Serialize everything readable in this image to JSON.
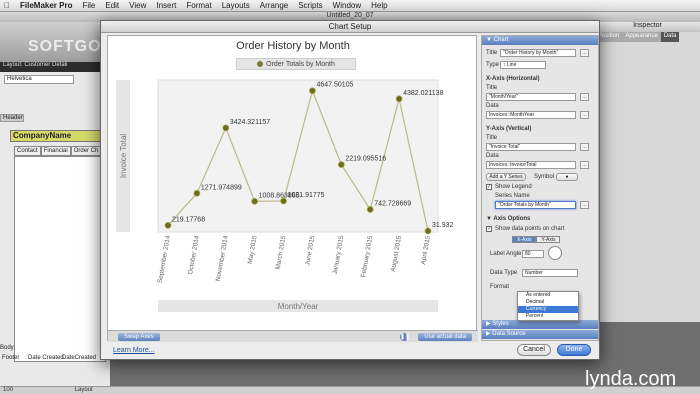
{
  "menubar": {
    "app": "FileMaker Pro",
    "items": [
      "File",
      "Edit",
      "View",
      "Insert",
      "Format",
      "Layouts",
      "Arrange",
      "Scripts",
      "Window",
      "Help"
    ]
  },
  "fm": {
    "window_title": "Untitled_20_07",
    "layout_bar": "Layout: Customer Detail",
    "layout_menu": "Helvetica",
    "header_label": "Header",
    "company_field": "CompanyName",
    "tabs": [
      "Contact",
      "Financial",
      "Order Ch"
    ],
    "body_label": "Body",
    "footer_label": "Footer",
    "footer_fields": [
      "Date Created",
      "DateCreated"
    ],
    "status_zoom": "100",
    "status_mode": "Layout"
  },
  "inspector": {
    "title": "Inspector",
    "tabs": [
      "Position",
      "Appearance",
      "Data"
    ]
  },
  "dialog": {
    "title": "Chart Setup",
    "learn_more": "Learn More...",
    "cancel": "Cancel",
    "done": "Done",
    "swap_axes": "Swap Axes",
    "use_actual_data": "Use actual data"
  },
  "chart_panel": {
    "section": "Chart",
    "title_label": "Title",
    "title_value": "\"Order History by Month\"",
    "type_label": "Type",
    "type_value": "Line",
    "xaxis_section": "X-Axis (Horizontal)",
    "x_title_label": "Title",
    "x_title_value": "\"Month/Year\"",
    "x_data_label": "Data",
    "x_data_value": "Invoices::MonthYear",
    "yaxis_section": "Y-Axis (Vertical)",
    "y_title_label": "Title",
    "y_title_value": "\"Invoice Total\"",
    "y_data_label": "Data",
    "y_data_value": "Invoices::InvoiceTotal",
    "add_y_series": "Add a Y Series",
    "symbol_label": "Symbol",
    "show_legend": "Show Legend",
    "series_name_label": "Series Name",
    "series_name_value": "\"Order Totals by Month\"",
    "axis_options": "Axis Options",
    "show_data_points": "Show data points on chart",
    "seg_options": [
      "X-Axis",
      "Y-Axis"
    ],
    "label_angle_label": "Label Angle",
    "label_angle_value": "80",
    "data_type_label": "Data Type",
    "data_type_value": "Number",
    "format_label": "Format",
    "format_options": [
      "As entered",
      "Decimal",
      "Currency",
      "Percent"
    ],
    "format_selected": "Currency",
    "styles_section": "Styles",
    "data_source_section": "Data Source"
  },
  "chart_data": {
    "type": "line",
    "title": "Order History by Month",
    "xlabel": "Month/Year",
    "ylabel": "Invoice Total",
    "legend": "Order Totals by Month",
    "legend_position": "top",
    "categories": [
      "September 2014",
      "October 2014",
      "November 2014",
      "May 2015",
      "March 2015",
      "June 2015",
      "January 2015",
      "February 2015",
      "August 2015",
      "April 2015"
    ],
    "values": [
      219.1768,
      1271.974899,
      3424.321157,
      1008.863,
      1021.91775,
      4647.50105,
      2219.095516,
      742.728669,
      4382.021138,
      31.93
    ],
    "data_labels": [
      "219.17768",
      "1271.974899",
      "3424.321157",
      "1008.863885",
      "1021.91775",
      "4647.50105",
      "2219.095516",
      "742.728669",
      "4382.021138",
      "31.932"
    ],
    "ylim": [
      0,
      5000
    ],
    "grid": true,
    "series_color": "#b9b98a",
    "point_color": "#6b6b1e"
  },
  "watermark": "SOFTGOZAR.COM",
  "brand": "lynda.com"
}
